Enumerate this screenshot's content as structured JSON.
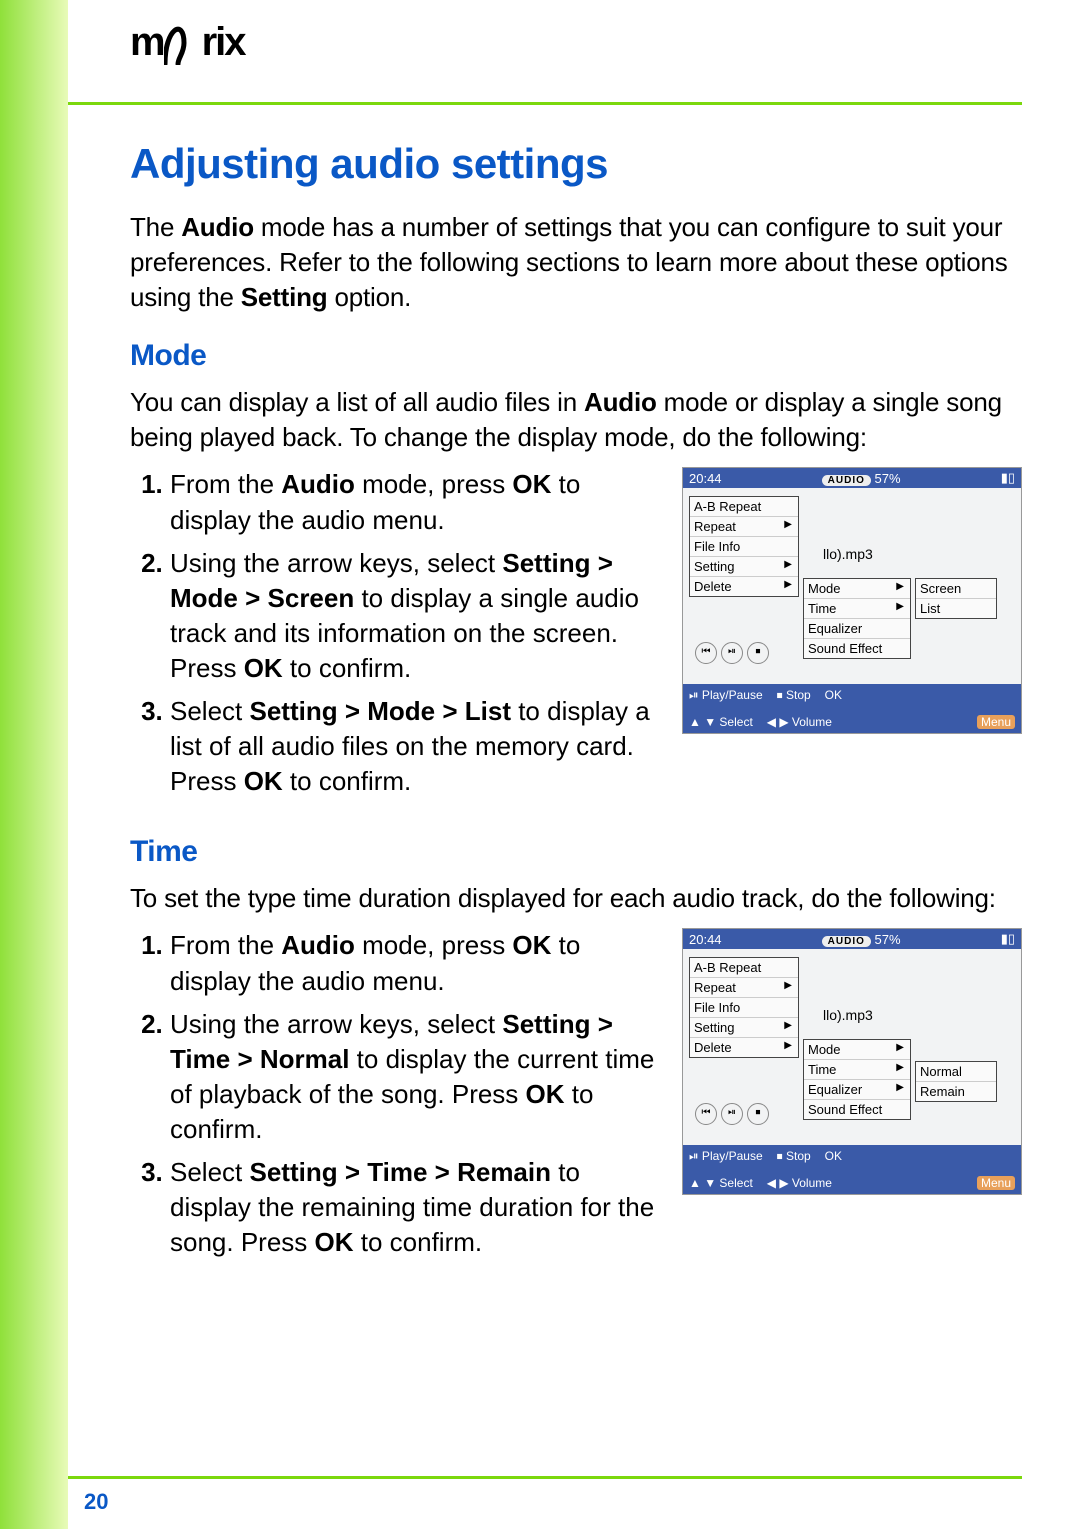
{
  "logo": "mVrix",
  "title": "Adjusting audio settings",
  "intro": {
    "p1a": "The ",
    "p1b": "Audio",
    "p1c": " mode has a number of settings that you can configure to suit your preferences. Refer to the following sections to learn more about these options using the ",
    "p1d": "Setting",
    "p1e": " option."
  },
  "mode": {
    "heading": "Mode",
    "intro_a": "You can display a list of all audio files in ",
    "intro_b": "Audio",
    "intro_c": " mode or display a single song being played back. To change the display mode, do the following:",
    "s1a": "From the ",
    "s1b": "Audio",
    "s1c": " mode, press ",
    "s1d": "OK",
    "s1e": " to display the audio menu.",
    "s2a": "Using the arrow keys, select ",
    "s2b": "Setting > Mode > Screen",
    "s2c": " to display a single audio track and its information on the screen. Press ",
    "s2d": "OK",
    "s2e": " to confirm.",
    "s3a": "Select ",
    "s3b": "Setting > Mode > List",
    "s3c": " to display a list of all audio files on the memory card. Press ",
    "s3d": "OK",
    "s3e": " to confirm."
  },
  "time": {
    "heading": "Time",
    "intro": "To set the type time duration displayed for each audio track, do the following:",
    "s1a": "From the ",
    "s1b": "Audio",
    "s1c": " mode, press ",
    "s1d": "OK",
    "s1e": " to display the audio menu.",
    "s2a": "Using the arrow keys, select ",
    "s2b": "Setting > Time > Normal",
    "s2c": " to display the current time of playback of the song. Press ",
    "s2d": "OK",
    "s2e": " to confirm.",
    "s3a": "Select ",
    "s3b": "Setting > Time > Remain",
    "s3c": " to display the remaining time duration for the song. Press ",
    "s3d": "OK",
    "s3e": " to confirm."
  },
  "device": {
    "clock": "20:44",
    "audio_pill": "AUDIO",
    "battery_pct": "57%",
    "song": "llo).mp3",
    "footer": {
      "play": "⏯ Play/Pause",
      "stop": "⏹ Stop",
      "select": "▲ ▼ Select",
      "volume": "◀ ▶ Volume",
      "ok": "OK",
      "menu": "Menu"
    },
    "menu1": [
      "A-B Repeat",
      "Repeat",
      "File Info",
      "Setting",
      "Delete"
    ],
    "menu2": [
      "Mode",
      "Time",
      "Equalizer",
      "Sound Effect"
    ],
    "mode_opts": [
      "Screen",
      "List"
    ],
    "time_opts": [
      "Normal",
      "Remain"
    ]
  },
  "page_number": "20"
}
